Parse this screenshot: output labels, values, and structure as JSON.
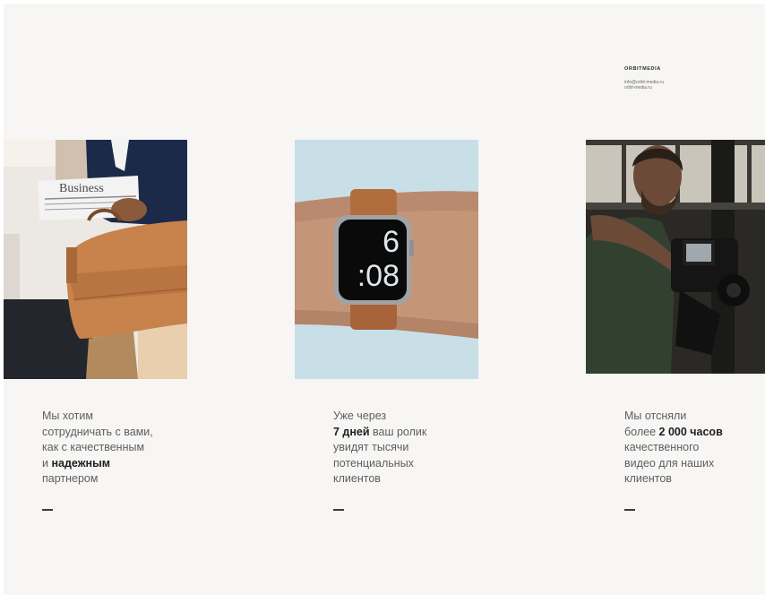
{
  "brand": {
    "name": "ORBITMEDIA",
    "email": "info@orbit-media.ru",
    "site": "orbit-media.ru"
  },
  "cards": [
    {
      "line1": "Мы хотим",
      "line2": "сотрудничать с вами,",
      "line3": "как с качественным",
      "line4_pre": "и ",
      "line4_bold": "надежным",
      "line5": "партнером"
    },
    {
      "line1": "Уже через",
      "line2_bold": "7 дней",
      "line2_post": " ваш ролик",
      "line3": "увидят тысячи",
      "line4": "потенциальных",
      "line5": "клиентов"
    },
    {
      "line1": "Мы отсняли",
      "line2_pre": "более ",
      "line2_bold": "2 000 часов",
      "line3": "качественного",
      "line4": "видео для наших",
      "line5": "клиентов"
    }
  ],
  "watch": {
    "hour": "6",
    "minutes": ":08"
  },
  "newspaper_text": "Business"
}
